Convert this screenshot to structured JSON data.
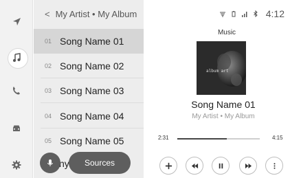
{
  "rail": {
    "items": [
      {
        "icon": "navigation-icon"
      },
      {
        "icon": "music-note-icon",
        "active": true
      },
      {
        "icon": "phone-icon"
      },
      {
        "icon": "car-icon"
      },
      {
        "icon": "settings-icon"
      }
    ]
  },
  "list": {
    "back_glyph": "<",
    "breadcrumb": "My Artist • My Album",
    "songs": [
      {
        "num": "01",
        "name": "Song Name 01",
        "selected": true
      },
      {
        "num": "02",
        "name": "Song Name 02"
      },
      {
        "num": "03",
        "name": "Song Name 03"
      },
      {
        "num": "04",
        "name": "Song Name 04"
      },
      {
        "num": "05",
        "name": "Song Name 05"
      }
    ],
    "peek_text": "ny",
    "sources_label": "Sources"
  },
  "status": {
    "icons": [
      "wireless-charging-icon",
      "battery-icon",
      "signal-icon",
      "bluetooth-icon"
    ],
    "time": "4:12"
  },
  "player": {
    "source": "Music",
    "album_art_text": "album art",
    "song_title": "Song Name 01",
    "artist_album": "My Artist • My Album",
    "elapsed": "2:31",
    "total": "4:15",
    "progress_fraction": 0.6,
    "controls": [
      "add-icon",
      "rewind-icon",
      "pause-icon",
      "fast-forward-icon",
      "more-icon"
    ]
  },
  "colors": {
    "rail_bg": "#f2f2f2",
    "list_bg": "#ededed",
    "selected_row": "#d6d6d6",
    "pill_bg": "#5e5e5e"
  }
}
